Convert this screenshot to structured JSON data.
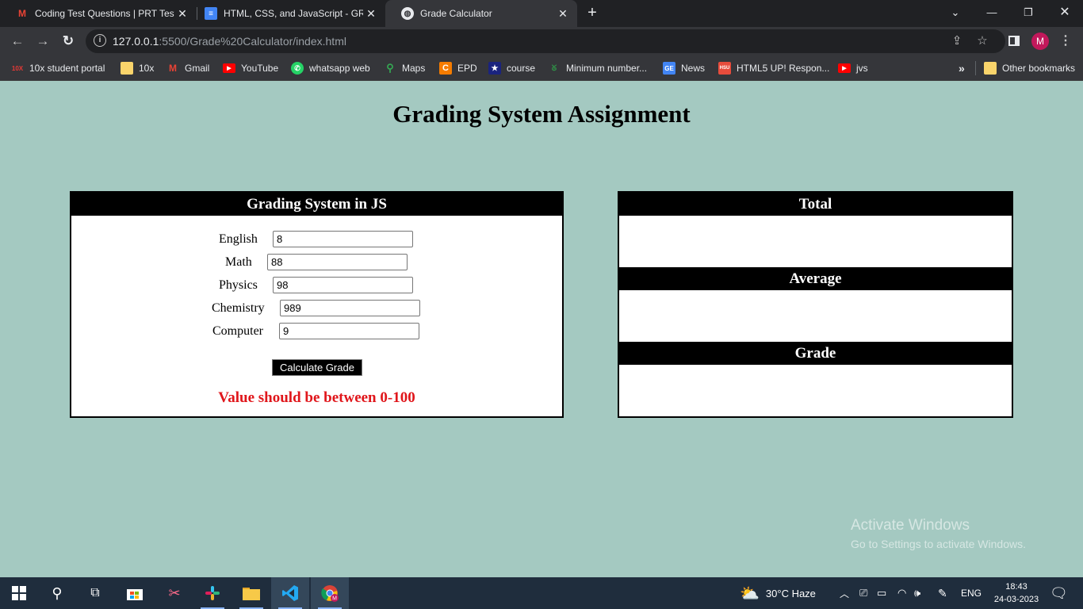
{
  "browser": {
    "tabs": [
      {
        "title": "Coding Test Questions | PRT Test",
        "icon": "gmail-icon"
      },
      {
        "title": "HTML, CSS, and JavaScript - GRA",
        "icon": "docs-icon"
      },
      {
        "title": "Grade Calculator",
        "icon": "globe-icon"
      }
    ],
    "url_host": "127.0.0.1",
    "url_path": ":5500/Grade%20Calculator/index.html",
    "bookmarks": [
      {
        "label": "10x student portal",
        "icon": "10x-icon"
      },
      {
        "label": "10x",
        "icon": "folder-icon"
      },
      {
        "label": "Gmail",
        "icon": "gmail-icon"
      },
      {
        "label": "YouTube",
        "icon": "youtube-icon"
      },
      {
        "label": "whatsapp web",
        "icon": "whatsapp-icon"
      },
      {
        "label": "Maps",
        "icon": "maps-icon"
      },
      {
        "label": "EPD",
        "icon": "epd-icon"
      },
      {
        "label": "course",
        "icon": "star-icon"
      },
      {
        "label": "Minimum number...",
        "icon": "gfg-icon"
      },
      {
        "label": "News",
        "icon": "news-icon"
      },
      {
        "label": "HTML5 UP! Respon...",
        "icon": "html5up-icon"
      },
      {
        "label": "jvs",
        "icon": "youtube-icon"
      }
    ],
    "bookmarks_overflow": "»",
    "other_bookmarks": "Other bookmarks",
    "profile_initial": "M"
  },
  "page": {
    "title": "Grading System Assignment",
    "form": {
      "heading": "Grading System in JS",
      "fields": [
        {
          "label": "English",
          "value": "8"
        },
        {
          "label": "Math",
          "value": "88"
        },
        {
          "label": "Physics",
          "value": "98"
        },
        {
          "label": "Chemistry",
          "value": "989"
        },
        {
          "label": "Computer",
          "value": "9"
        }
      ],
      "button": "Calculate Grade",
      "error": "Value should be between 0-100"
    },
    "results": {
      "total_heading": "Total",
      "total_value": "",
      "average_heading": "Average",
      "average_value": "",
      "grade_heading": "Grade",
      "grade_value": ""
    }
  },
  "watermark": {
    "line1": "Activate Windows",
    "line2": "Go to Settings to activate Windows."
  },
  "taskbar": {
    "weather": "30°C  Haze",
    "language": "ENG",
    "time": "18:43",
    "date": "24-03-2023"
  }
}
